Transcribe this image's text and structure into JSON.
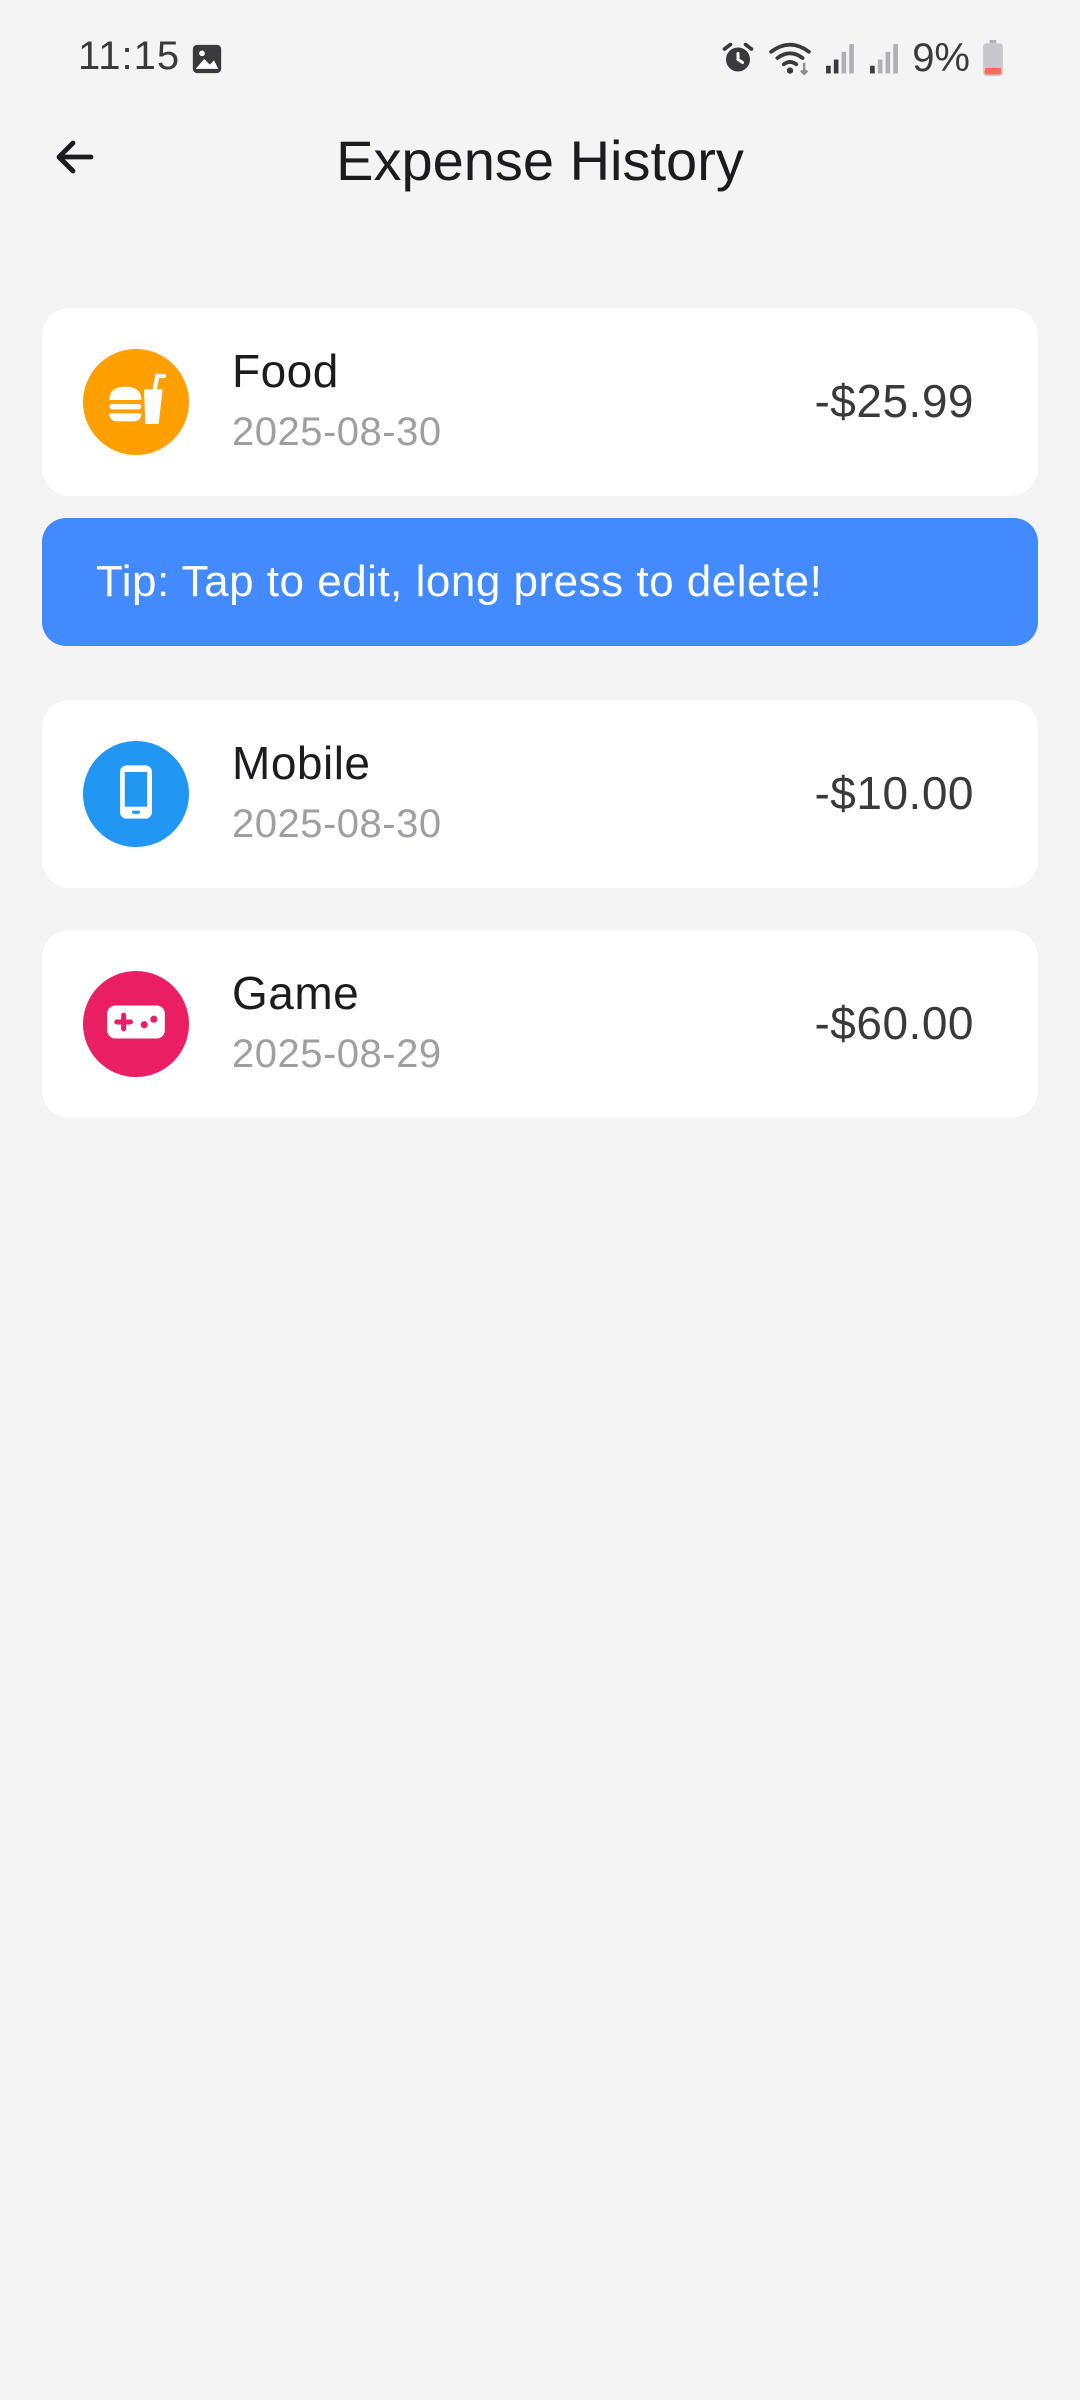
{
  "status_bar": {
    "time": "11:15",
    "battery": "9%",
    "icons": [
      "gallery-icon",
      "alarm-icon",
      "wifi-icon",
      "signal-icon",
      "signal-icon",
      "battery-icon"
    ]
  },
  "header": {
    "title": "Expense History",
    "back_icon": "arrow-left-icon"
  },
  "tip": {
    "text": "Tip: Tap to edit, long press to delete!",
    "color": "#448aff"
  },
  "expenses": [
    {
      "name": "Food",
      "date": "2025-08-30",
      "amount": "-$25.99",
      "icon": "fastfood-icon",
      "color": "#ffa000"
    },
    {
      "name": "Mobile",
      "date": "2025-08-30",
      "amount": "-$10.00",
      "icon": "smartphone-icon",
      "color": "#2196f3"
    },
    {
      "name": "Game",
      "date": "2025-08-29",
      "amount": "-$60.00",
      "icon": "gamepad-icon",
      "color": "#e91e63"
    }
  ]
}
